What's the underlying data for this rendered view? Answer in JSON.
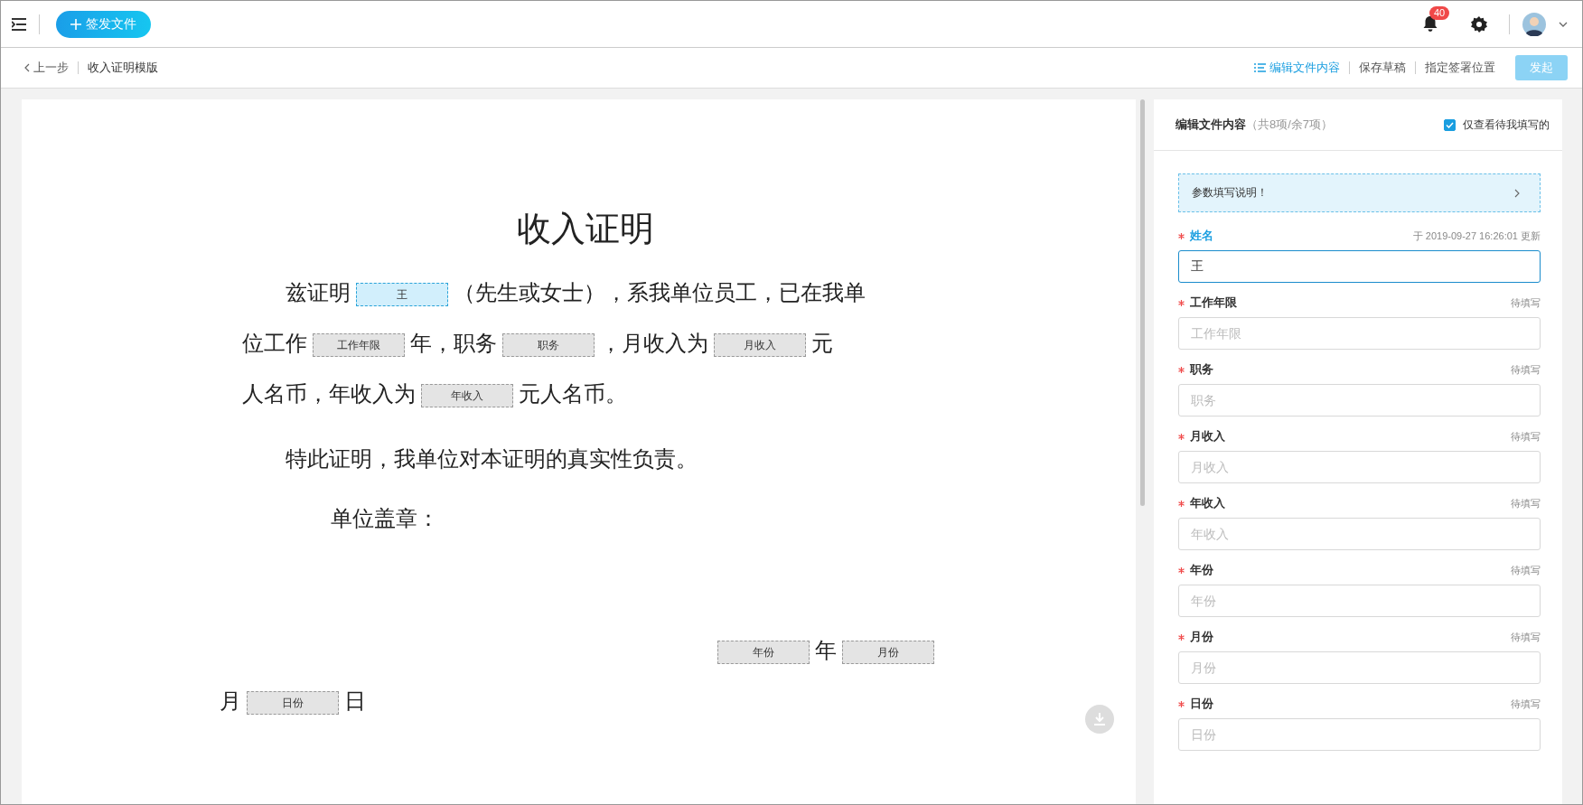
{
  "topbar": {
    "new_button": "签发文件",
    "notifications": "40"
  },
  "toolbar": {
    "back": "上一步",
    "doc_title": "收入证明模版",
    "actions": [
      {
        "label": "编辑文件内容",
        "selected": true,
        "kind": "list-link"
      },
      {
        "label": "保存草稿",
        "selected": false,
        "kind": "link"
      },
      {
        "label": "指定签署位置",
        "selected": false,
        "kind": "link"
      }
    ],
    "submit": {
      "label": "发起",
      "disabled": true
    }
  },
  "document": {
    "paragraphs": [
      {
        "kind": "title",
        "segments": [
          {
            "kind": "text",
            "text": "收入证明"
          }
        ]
      },
      {
        "kind": "first",
        "segments": [
          {
            "kind": "text",
            "text": "兹证明"
          },
          {
            "kind": "field",
            "text": "王",
            "selected": true
          },
          {
            "kind": "text",
            "text": "（先生或女士），系我单位员工，已在我单"
          }
        ]
      },
      {
        "kind": "line",
        "segments": [
          {
            "kind": "text",
            "text": "位工作"
          },
          {
            "kind": "field",
            "text": "工作年限",
            "selected": false
          },
          {
            "kind": "text",
            "text": "年，职务"
          },
          {
            "kind": "field",
            "text": "职务",
            "selected": false
          },
          {
            "kind": "text",
            "text": "，月收入为"
          },
          {
            "kind": "field",
            "text": "月收入",
            "selected": false
          },
          {
            "kind": "text",
            "text": "元"
          }
        ]
      },
      {
        "kind": "line",
        "segments": [
          {
            "kind": "text",
            "text": "人名币，年收入为"
          },
          {
            "kind": "field",
            "text": "年收入",
            "selected": false
          },
          {
            "kind": "text",
            "text": "元人名币。"
          }
        ]
      },
      {
        "kind": "first",
        "segments": [
          {
            "kind": "text",
            "text": "特此证明，我单位对本证明的真实性负责。"
          }
        ]
      },
      {
        "kind": "stamp",
        "segments": [
          {
            "kind": "text",
            "text": "单位盖章："
          }
        ]
      },
      {
        "kind": "date",
        "segments": [
          {
            "kind": "field",
            "text": "年份",
            "selected": false
          },
          {
            "kind": "text",
            "text": "年"
          },
          {
            "kind": "field",
            "text": "月份",
            "selected": false
          }
        ]
      },
      {
        "kind": "dateline",
        "segments": [
          {
            "kind": "text",
            "text": "月"
          },
          {
            "kind": "field",
            "text": "日份",
            "selected": false
          },
          {
            "kind": "text",
            "text": "日"
          }
        ]
      }
    ]
  },
  "panel": {
    "title": "编辑文件内容",
    "count": "（共8项/余7项）",
    "filter": {
      "label": "仅查看待我填写的",
      "checked": true
    },
    "notice": "参数填写说明！",
    "fields": [
      {
        "label": "姓名",
        "required": true,
        "status": "于 2019-09-27 16:26:01 更新",
        "value": "王",
        "selected": true
      },
      {
        "label": "工作年限",
        "required": true,
        "status": "待填写",
        "placeholder": "工作年限",
        "selected": false
      },
      {
        "label": "职务",
        "required": true,
        "status": "待填写",
        "placeholder": "职务",
        "selected": false
      },
      {
        "label": "月收入",
        "required": true,
        "status": "待填写",
        "placeholder": "月收入",
        "selected": false
      },
      {
        "label": "年收入",
        "required": true,
        "status": "待填写",
        "placeholder": "年收入",
        "selected": false
      },
      {
        "label": "年份",
        "required": true,
        "status": "待填写",
        "placeholder": "年份",
        "selected": false
      },
      {
        "label": "月份",
        "required": true,
        "status": "待填写",
        "placeholder": "月份",
        "selected": false
      },
      {
        "label": "日份",
        "required": true,
        "status": "待填写",
        "placeholder": "日份",
        "selected": false
      }
    ]
  }
}
